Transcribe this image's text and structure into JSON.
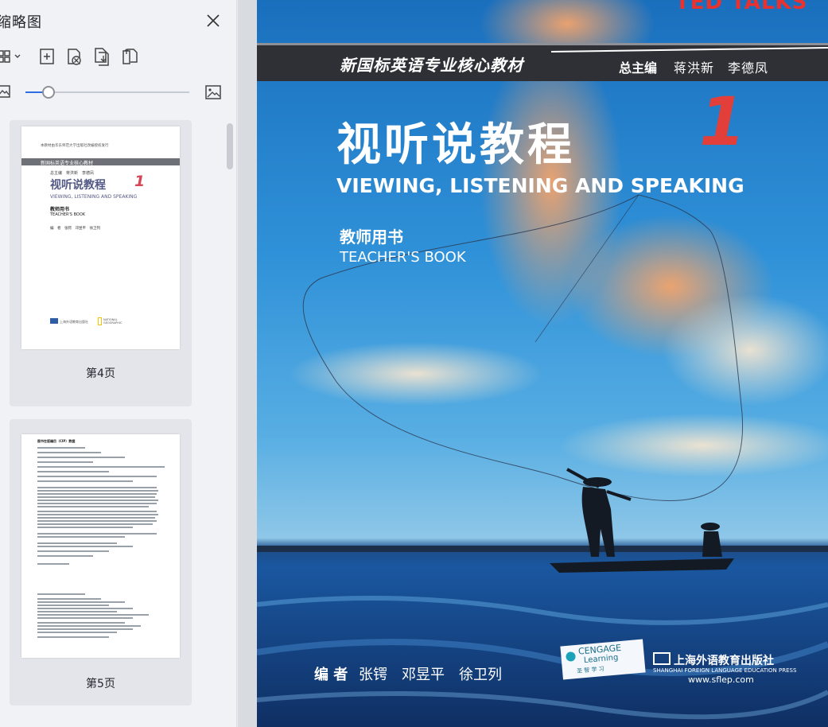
{
  "sidebar": {
    "title": "缩略图",
    "pages": [
      {
        "label": "第4页"
      },
      {
        "label": "第5页"
      }
    ]
  },
  "thumb4": {
    "top_note": "本教材由华东师范大学出版社改编授权发行",
    "series": "新国标英语专业核心教材",
    "editor": "总主编　蒋洪新　李德凤",
    "title_cn": "视听说教程",
    "number": "1",
    "title_en": "VIEWING, LISTENING AND SPEAKING",
    "book_cn": "教师用书",
    "book_en": "TEACHER'S BOOK",
    "authors": "编　者　张锷　邓昱平　徐卫列",
    "publisher": "上海外语教育出版社",
    "ng": "NATIONAL GEOGRAPHIC"
  },
  "thumb5": {
    "heading": "图书在版编目（CIP）数据"
  },
  "cover": {
    "brand": "TED TALKS",
    "series": "新国标英语专业核心教材",
    "editor_label": "总主编",
    "editor_names": "蒋洪新　李德凤",
    "title_cn": "视听说教程",
    "number": "1",
    "title_en": "VIEWING, LISTENING AND SPEAKING",
    "book_cn": "教师用书",
    "book_en": "TEACHER'S BOOK",
    "authors_label": "编 者",
    "authors": "张锷　邓昱平　徐卫列",
    "cengage": "CENGAGE",
    "learning": "Learning",
    "cengage_cn": "圣  智  学  习",
    "publisher": "上海外语教育出版社",
    "publisher_en": "SHANGHAI FOREIGN LANGUAGE EDUCATION PRESS",
    "url": "www.sflep.com"
  }
}
